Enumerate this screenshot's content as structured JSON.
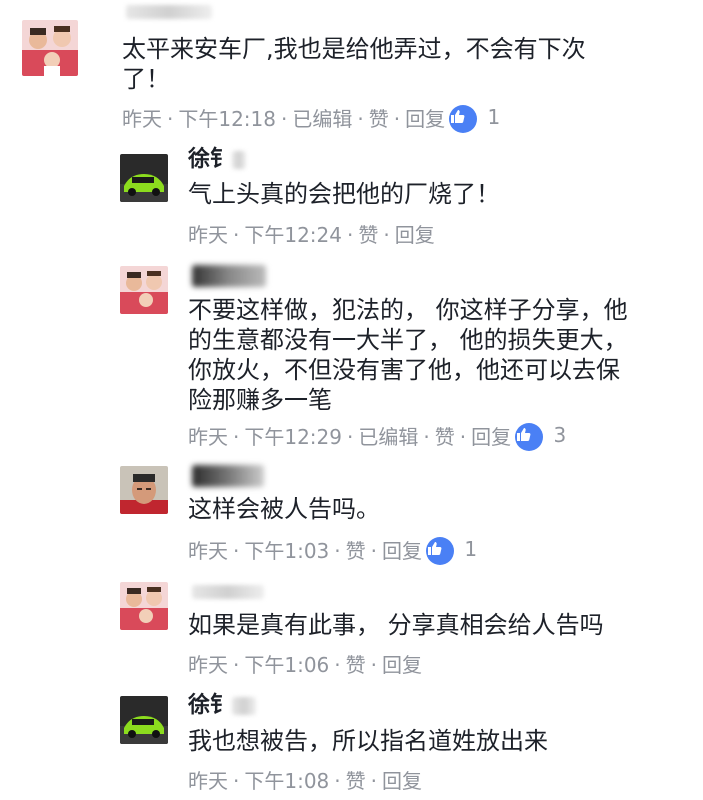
{
  "comments": [
    {
      "name": "林宏闯",
      "text": "太平来安车厂,我也是给他弄过，不会有下次\n了！",
      "time": "昨天",
      "clock": "下午12:18",
      "edited": "已编辑",
      "like": "赞",
      "reply": "回复",
      "likes": "1",
      "avatar": "family-photo"
    },
    {
      "name": "徐钅",
      "text": "气上头真的会把他的厂烧了！",
      "time": "昨天",
      "clock": "下午12:24",
      "like": "赞",
      "reply": "回复",
      "avatar": "green-car"
    },
    {
      "name": "",
      "text": "不要这样做，犯法的， 你这样子分享，他\n的生意都没有一大半了， 他的损失更大，\n你放火，不但没有害了他，他还可以去保\n险那赚多一笔",
      "time": "昨天",
      "clock": "下午12:29",
      "edited": "已编辑",
      "like": "赞",
      "reply": "回复",
      "likes": "3",
      "avatar": "family-photo"
    },
    {
      "name": "",
      "text": "这样会被人告吗。",
      "time": "昨天",
      "clock": "下午1:03",
      "like": "赞",
      "reply": "回复",
      "likes": "1",
      "avatar": "man-portrait"
    },
    {
      "name": "",
      "text": "如果是真有此事， 分享真相会给人告吗",
      "time": "昨天",
      "clock": "下午1:06",
      "like": "赞",
      "reply": "回复",
      "avatar": "family-photo"
    },
    {
      "name": "徐钅",
      "text": "我也想被告，所以指名道姓放出来",
      "time": "昨天",
      "clock": "下午1:08",
      "like": "赞",
      "reply": "回复",
      "avatar": "green-car"
    }
  ],
  "colors": {
    "like_badge": "#4a80f5",
    "meta_text": "#90949c",
    "body_text": "#1d2129"
  }
}
